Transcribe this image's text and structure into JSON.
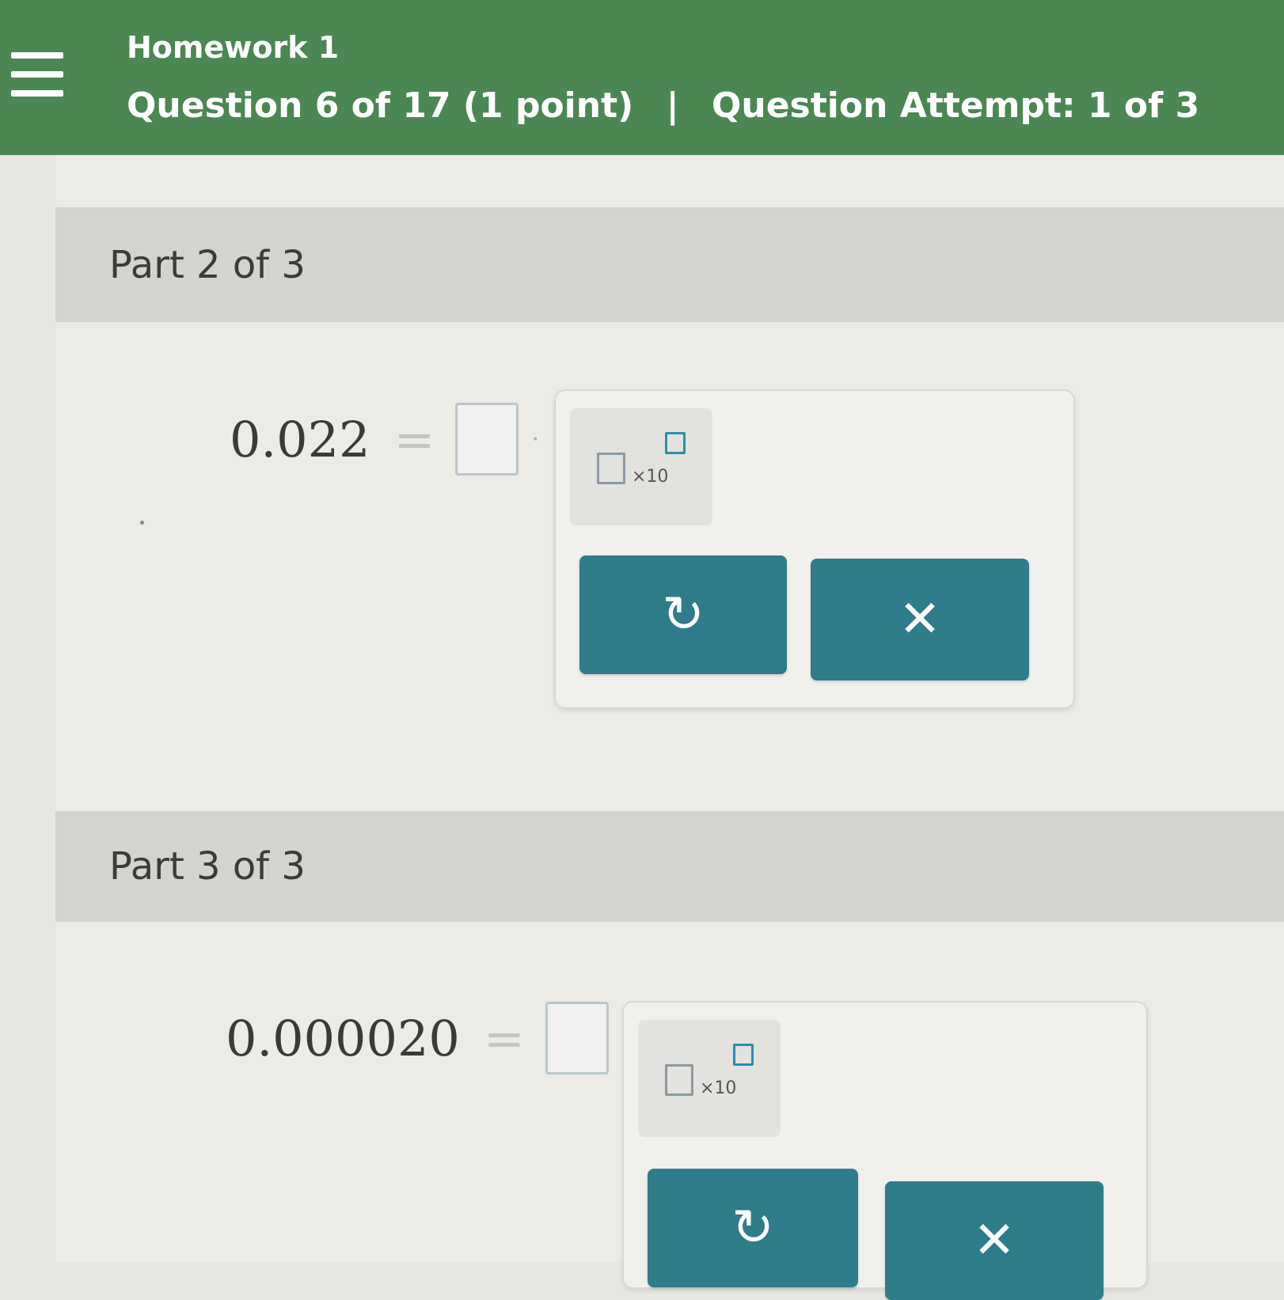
{
  "header": {
    "title": "Homework 1",
    "question": "Question 6 of 17 (1 point)",
    "separator": "|",
    "attempt": "Question Attempt: 1 of 3"
  },
  "parts": [
    {
      "label": "Part 2 of 3",
      "value": "0.022",
      "equals": "=",
      "trailing": "·",
      "answer": "",
      "sci_label": "×10",
      "undo_icon": "↻",
      "clear_icon": "✕"
    },
    {
      "label": "Part 3 of 3",
      "value": "0.000020",
      "equals": "=",
      "answer": "",
      "sci_label": "×10",
      "undo_icon": "↻",
      "clear_icon": "✕"
    }
  ],
  "colors": {
    "header_bg": "#4a8752",
    "part_bar": "#d3d3d0",
    "action_button": "#2f7c8a",
    "exponent_box": "#2b8fa8"
  }
}
